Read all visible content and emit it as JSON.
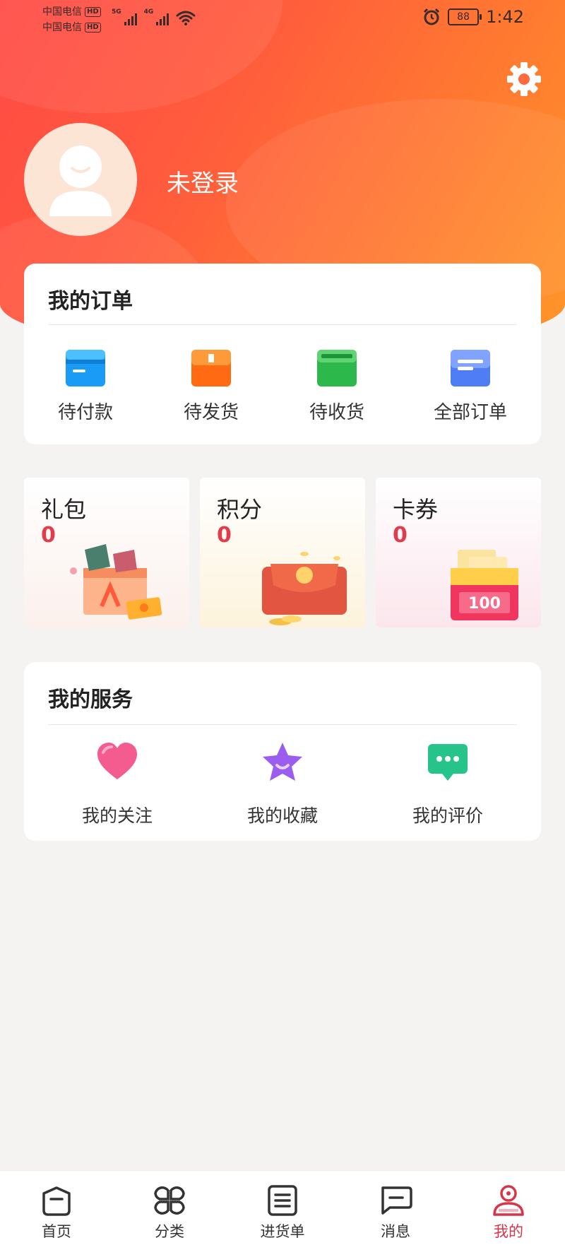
{
  "status_bar": {
    "carrier_1": "中国电信",
    "carrier_2": "中国电信",
    "hd_badge": "HD",
    "net_1": "5G",
    "net_2": "4G",
    "battery": "88",
    "time": "1:42"
  },
  "profile": {
    "username": "未登录"
  },
  "orders": {
    "title": "我的订单",
    "items": [
      {
        "label": "待付款",
        "icon": "wallet-icon",
        "color": "#1a9bf5"
      },
      {
        "label": "待发货",
        "icon": "package-icon",
        "color": "#ff6a13"
      },
      {
        "label": "待收货",
        "icon": "box-icon",
        "color": "#2db84b"
      },
      {
        "label": "全部订单",
        "icon": "list-icon",
        "color": "#4f7df5"
      }
    ]
  },
  "promos": [
    {
      "title": "礼包",
      "value": "0",
      "illustration": "gift-box"
    },
    {
      "title": "积分",
      "value": "0",
      "illustration": "red-envelope-coins"
    },
    {
      "title": "卡券",
      "value": "0",
      "illustration": "coupon-envelope",
      "coupon_text": "100"
    }
  ],
  "services": {
    "title": "我的服务",
    "items": [
      {
        "label": "我的关注",
        "icon": "heart-icon",
        "color": "#f45b8e"
      },
      {
        "label": "我的收藏",
        "icon": "star-icon",
        "color": "#9b5cf0"
      },
      {
        "label": "我的评价",
        "icon": "comment-icon",
        "color": "#26c48a"
      }
    ]
  },
  "tabbar": {
    "items": [
      {
        "label": "首页",
        "icon": "home-icon",
        "active": false
      },
      {
        "label": "分类",
        "icon": "category-icon",
        "active": false
      },
      {
        "label": "进货单",
        "icon": "purchase-list-icon",
        "active": false
      },
      {
        "label": "消息",
        "icon": "message-icon",
        "active": false
      },
      {
        "label": "我的",
        "icon": "profile-icon",
        "active": true
      }
    ],
    "active_color": "#d8344a"
  },
  "colors": {
    "hero_start": "#ff4a45",
    "hero_end": "#ff962a",
    "value_red": "#e23b4c",
    "page_bg": "#f4f3f2"
  }
}
